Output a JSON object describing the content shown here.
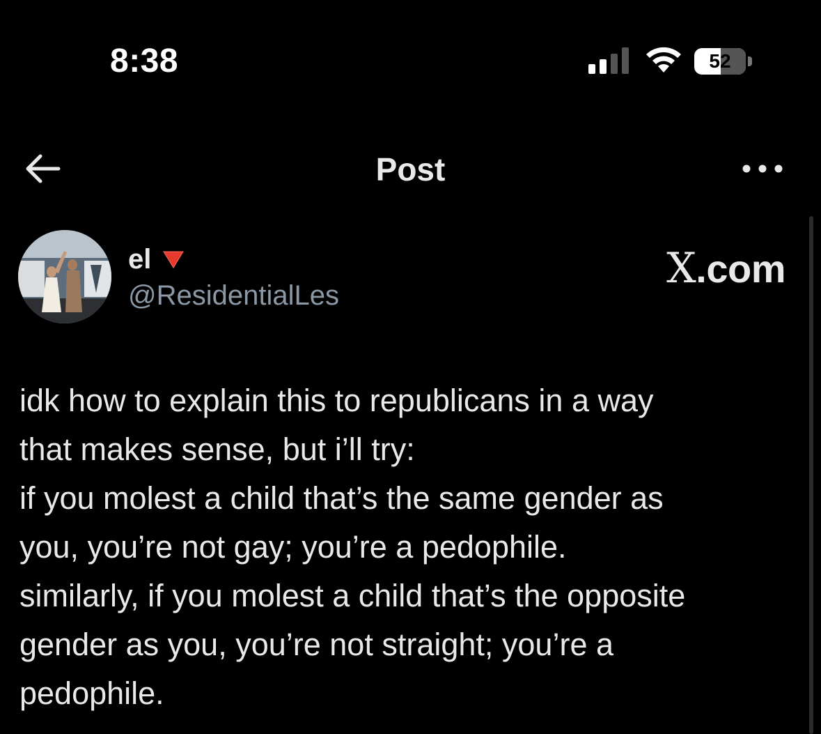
{
  "status_bar": {
    "time": "8:38",
    "battery_level": "52",
    "battery_fraction": 0.52,
    "signal_bars_active": 2,
    "signal_bars_total": 4
  },
  "nav": {
    "title": "Post",
    "back_icon": "arrow-left-icon",
    "more_icon": "more-horizontal-icon"
  },
  "author": {
    "display_name": "el",
    "flag_icon": "red-triangle-down-icon",
    "handle": "@ResidentialLes"
  },
  "watermark": {
    "prefix": "X",
    "suffix": ".com"
  },
  "post": {
    "lines": [
      "idk how to explain this to republicans in a way",
      "that makes sense, but i’ll try:",
      "if you molest a child that’s the same gender as",
      "you, you’re not gay; you’re a pedophile.",
      "similarly, if you molest a child that’s the opposite",
      "gender as you, you’re not straight; you’re a",
      "pedophile."
    ]
  },
  "colors": {
    "background": "#000000",
    "text_primary": "#e7e9ea",
    "text_secondary": "#8b98a5",
    "flag": "#e8392e"
  }
}
